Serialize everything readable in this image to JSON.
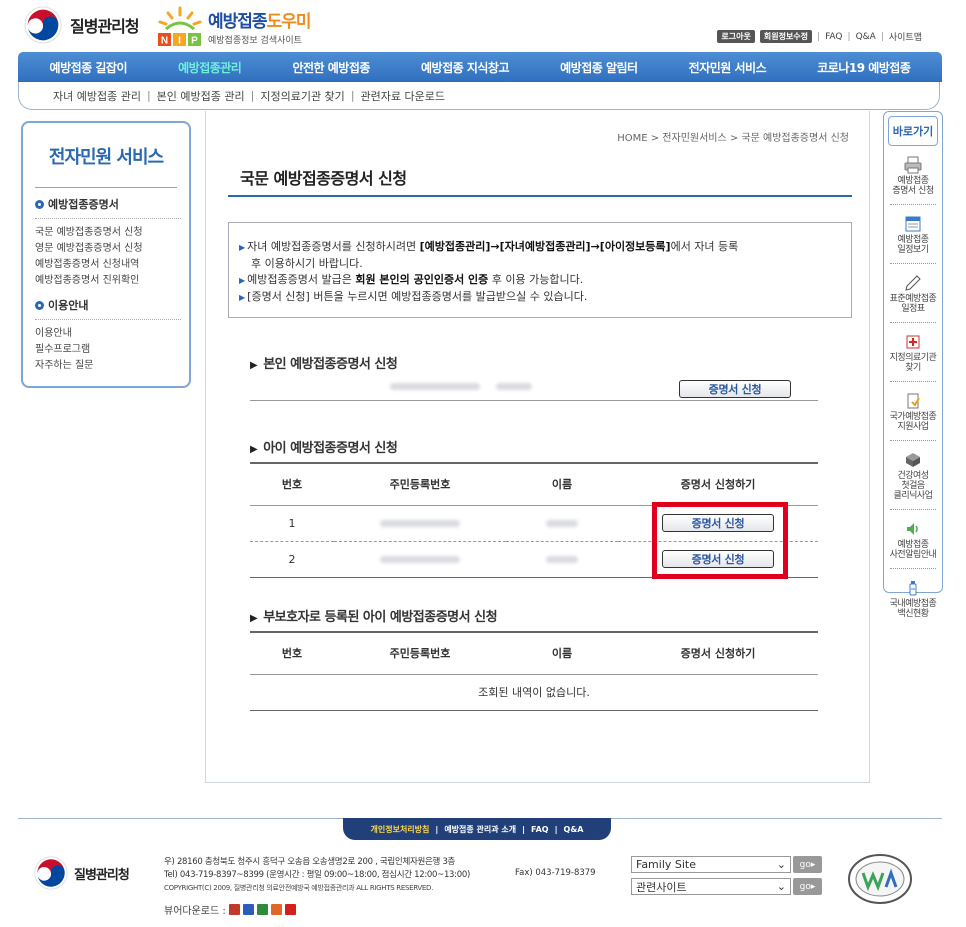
{
  "header": {
    "org_name": "질병관리청",
    "site_title_main": "예방접종",
    "site_title_accent": "도우미",
    "site_badge": "NIP",
    "site_subtitle": "예방접종정보 검색사이트",
    "util": {
      "logout": "로그아웃",
      "member_edit": "회원정보수정",
      "faq": "FAQ",
      "qna": "Q&A",
      "sitemap": "사이트맵"
    }
  },
  "gnb": {
    "items": [
      {
        "label": "예방접종 길잡이"
      },
      {
        "label": "예방접종관리"
      },
      {
        "label": "안전한 예방접종"
      },
      {
        "label": "예방접종 지식창고"
      },
      {
        "label": "예방접종 알림터"
      },
      {
        "label": "전자민원 서비스"
      },
      {
        "label": "코로나19 예방접종"
      }
    ],
    "sub_items": [
      {
        "label": "자녀 예방접종 관리"
      },
      {
        "label": "본인 예방접종 관리"
      },
      {
        "label": "지정의료기관 찾기"
      },
      {
        "label": "관련자료 다운로드"
      }
    ]
  },
  "lnb": {
    "title": "전자민원 서비스",
    "group1": {
      "label": "예방접종증명서",
      "items": [
        "국문 예방접종증명서 신청",
        "영문 예방접종증명서 신청",
        "예방접종증명서 신청내역",
        "예방접종증명서 진위확인"
      ]
    },
    "group2": {
      "label": "이용안내",
      "items": [
        "이용안내",
        "필수프로그램",
        "자주하는 질문"
      ]
    }
  },
  "content": {
    "breadcrumb": "HOME > 전자민원서비스 > 국문 예방접종증명서 신청",
    "title": "국문 예방접종증명서 신청",
    "notice": {
      "line1_a": "자녀 예방접종증명서를 신청하시려면 ",
      "line1_b": "[예방접종관리]→[자녀예방접종관리]→[아이정보등록]",
      "line1_c": "에서 자녀 등록",
      "line1_cont": "후 이용하시기 바랍니다.",
      "line2_a": "예방접종증명서 발급은 ",
      "line2_b": "회원 본인의 공인인증서 인증",
      "line2_c": " 후 이용 가능합니다.",
      "line3": "[증명서 신청] 버튼을 누르시면 예방접종증명서를 발급받으실 수 있습니다."
    },
    "self_section": {
      "title": "본인 예방접종증명서 신청",
      "button": "증명서 신청"
    },
    "child_section": {
      "title": "아이 예방접종증명서 신청",
      "columns": [
        "번호",
        "주민등록번호",
        "이름",
        "증명서 신청하기"
      ],
      "rows": [
        {
          "no": "1",
          "button": "증명서 신청"
        },
        {
          "no": "2",
          "button": "증명서 신청"
        }
      ]
    },
    "guardian_section": {
      "title": "부보호자로 등록된 아이 예방접종증명서 신청",
      "columns": [
        "번호",
        "주민등록번호",
        "이름",
        "증명서 신청하기"
      ],
      "empty": "조회된 내역이 없습니다."
    }
  },
  "quick": {
    "title": "바로가기",
    "items": [
      {
        "line1": "예방접종",
        "line2": "증명서 신청",
        "icon": "printer-icon"
      },
      {
        "line1": "예방접종",
        "line2": "일정보기",
        "icon": "calendar-icon"
      },
      {
        "line1": "표준예방접종",
        "line2": "일정표",
        "icon": "pen-icon"
      },
      {
        "line1": "지정의료기관",
        "line2": "찾기",
        "icon": "medical-cross-icon"
      },
      {
        "line1": "국가예방접종",
        "line2": "지원사업",
        "icon": "document-icon"
      },
      {
        "line1": "건강여성",
        "line2": "첫걸음",
        "line3": "클리닉사업",
        "icon": "health-box-icon"
      },
      {
        "line1": "예방접종",
        "line2": "사전알림안내",
        "icon": "speaker-icon"
      },
      {
        "line1": "국내예방접종",
        "line2": "백신현황",
        "icon": "vaccine-icon"
      }
    ]
  },
  "footer": {
    "menu": [
      "개인정보처리방침",
      "예방접종 관리과 소개",
      "FAQ",
      "Q&A"
    ],
    "org_name": "질병관리청",
    "address": "우) 28160  충청북도 청주시 흥덕구 오송읍 오송생명2로 200 , 국립인체자원은행 3층",
    "tel": "Tel) 043-719-8397~8399 (운영시간 : 평일 09:00~18:00, 점심시간 12:00~13:00)",
    "fax": "Fax) 043-719-8379",
    "copyright": "COPYRIGHT(C) 2009, 질병관리청 의료안전예방국 예방접종관리과 ALL RIGHTS RESERVED.",
    "viewer_label": "뷰어다운로드 :",
    "family_site": "Family Site",
    "related_site": "관련사이트",
    "go": "go"
  },
  "colors": {
    "brand_blue": "#2f6fbe",
    "active_menu": "#6ff0dc",
    "highlight_red": "#e0001e"
  }
}
